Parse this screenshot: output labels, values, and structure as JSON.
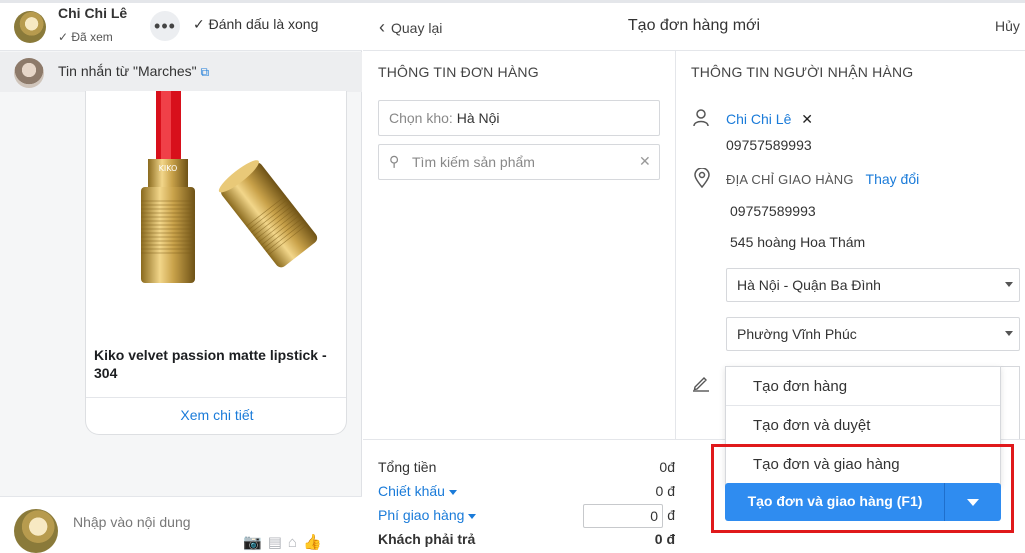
{
  "chat": {
    "contact_name": "Chi Chi Lê",
    "seen_label": "Đã xem",
    "mark_done_label": "Đánh dấu là xong",
    "message_from": "Tin nhắn từ  \"Marches\"",
    "product_title": "Kiko velvet passion matte lipstick - 304",
    "view_detail_label": "Xem chi tiết",
    "compose_placeholder": "Nhập vào nội dung",
    "product_brand": "KIKO"
  },
  "order": {
    "back_label": "Quay lại",
    "title": "Tạo đơn hàng mới",
    "cancel_label": "Hủy",
    "order_info_title": "THÔNG TIN ĐƠN HÀNG",
    "warehouse_label": "Chọn kho:",
    "warehouse_value": "Hà Nội",
    "search_placeholder": "Tìm kiếm sản phẩm",
    "receiver_title": "THÔNG TIN NGƯỜI NHẬN HÀNG",
    "customer_name": "Chi Chi Lê",
    "customer_phone": "09757589993",
    "address_label": "ĐỊA CHỈ GIAO HÀNG",
    "change_label": "Thay đổi",
    "address_phone": "09757589993",
    "address_street": "545 hoàng Hoa Thám",
    "district": "Hà Nội - Quận Ba Đình",
    "ward": "Phường Vĩnh Phúc"
  },
  "summary": {
    "total_label": "Tổng tiền",
    "total_value": "0đ",
    "discount_label": "Chiết khấu",
    "discount_value": "0 đ",
    "shipping_label": "Phí giao hàng",
    "shipping_input": "0",
    "shipping_value": "đ",
    "due_label": "Khách phải trả",
    "due_value": "0 đ"
  },
  "actions": {
    "menu": [
      "Tạo đơn hàng",
      "Tạo đơn và duyệt",
      "Tạo đơn và giao hàng"
    ],
    "primary_label": "Tạo đơn và giao hàng (F1)"
  },
  "colors": {
    "accent": "#1a7bd9",
    "button": "#2f8cf0",
    "highlight": "#e0191b"
  }
}
